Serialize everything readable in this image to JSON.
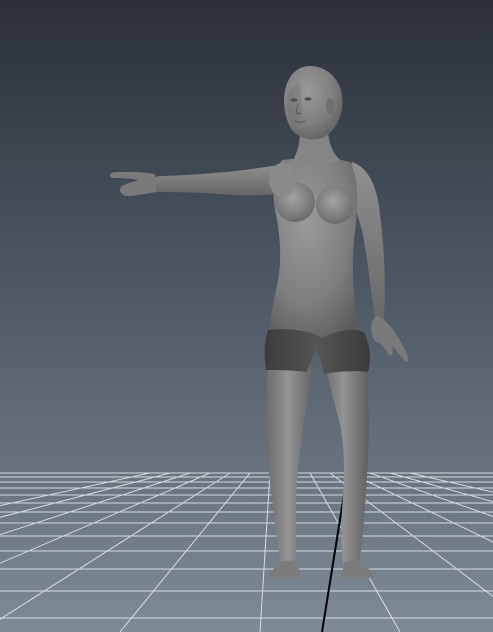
{
  "viewport": {
    "background_top": "#2b3038",
    "background_mid": "#4e5864",
    "background_bottom": "#7e8a96",
    "grid_color": "#e8ecef",
    "axis_color": "#000000"
  },
  "scene": {
    "model_icon": "human-figure-icon",
    "model_pose": "pointing",
    "model_color": "#7c7c7c",
    "shorts_color": "#4a4a4a"
  }
}
